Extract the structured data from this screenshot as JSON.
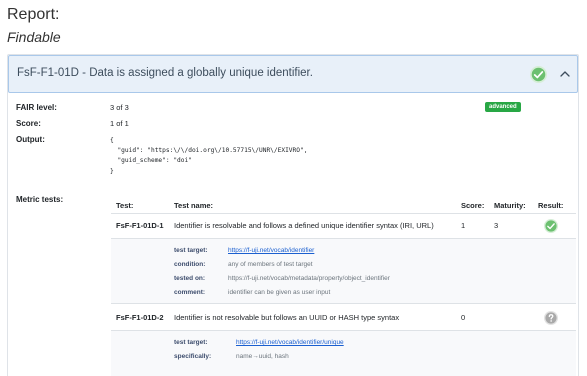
{
  "report": {
    "title": "Report:",
    "section": "Findable"
  },
  "card": {
    "header": "FsF-F1-01D - Data is assigned a globally unique identifier.",
    "status_icon": "check-circle-icon",
    "toggle_icon": "chevron-up-icon",
    "accent": "#28a745"
  },
  "summary": {
    "fair_level_label": "FAIR level:",
    "fair_level_value": "3 of 3",
    "badge": "advanced",
    "score_label": "Score:",
    "score_value": "1 of 1",
    "output_label": "Output:",
    "output_lines": [
      "{",
      "  \"guid\": \"https:\\/\\/doi.org\\/10.57715\\/UNR\\/EXIVRO\",",
      "  \"guid_scheme\": \"doi\"",
      "}"
    ],
    "metric_tests_label": "Metric tests:"
  },
  "table": {
    "headers": [
      "Test:",
      "Test name:",
      "Score:",
      "Maturity:",
      "Result:"
    ],
    "rows": [
      {
        "test": "FsF-F1-01D-1",
        "name": "Identifier is resolvable and follows a defined unique identifier syntax (IRI, URL)",
        "score": "1",
        "maturity": "3",
        "result_icon": "check-circle-icon",
        "details": [
          {
            "label": "test target:",
            "value": "https://f-uji.net/vocab/identifier",
            "link": true
          },
          {
            "label": "condition:",
            "value": "any of members of test target",
            "link": false
          },
          {
            "label": "tested on:",
            "value": "https://f-uji.net/vocab/metadata/property/object_identifier",
            "link": false
          },
          {
            "label": "comment:",
            "value": "identifier can be given as user input",
            "link": false
          }
        ]
      },
      {
        "test": "FsF-F1-01D-2",
        "name": "Identifier is not resolvable but follows an UUID or HASH type syntax",
        "score": "0",
        "maturity": "",
        "result_icon": "question-circle-icon",
        "details": [
          {
            "label": "test target:",
            "value": "https://f-uji.net/vocab/identifier/unique",
            "link": true
          },
          {
            "label": "specifically:",
            "value": "name→uuid, hash",
            "link": false
          }
        ]
      }
    ]
  }
}
